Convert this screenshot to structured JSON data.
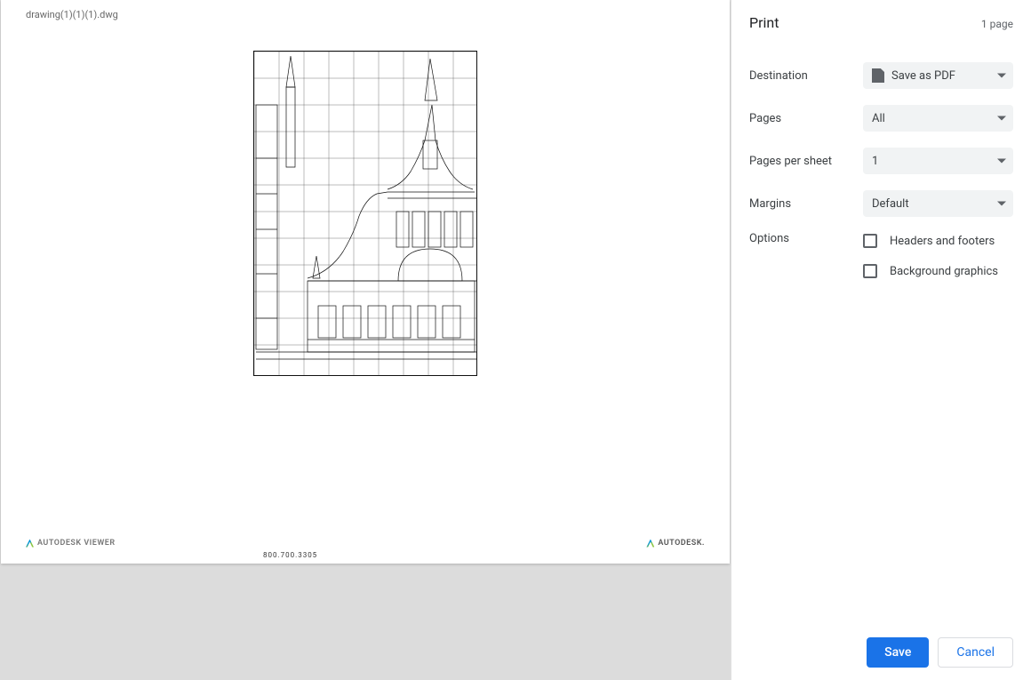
{
  "preview": {
    "filename": "drawing(1)(1)(1).dwg",
    "legend_number": "800.700.3305",
    "footer_left": "AUTODESK VIEWER",
    "footer_right": "AUTODESK."
  },
  "panel": {
    "title": "Print",
    "page_count_label": "1 page",
    "labels": {
      "destination": "Destination",
      "pages": "Pages",
      "pages_per_sheet": "Pages per sheet",
      "margins": "Margins",
      "options": "Options"
    },
    "values": {
      "destination": "Save as PDF",
      "pages": "All",
      "pages_per_sheet": "1",
      "margins": "Default"
    },
    "options": {
      "headers_footers": "Headers and footers",
      "background_graphics": "Background graphics"
    },
    "buttons": {
      "save": "Save",
      "cancel": "Cancel"
    }
  }
}
